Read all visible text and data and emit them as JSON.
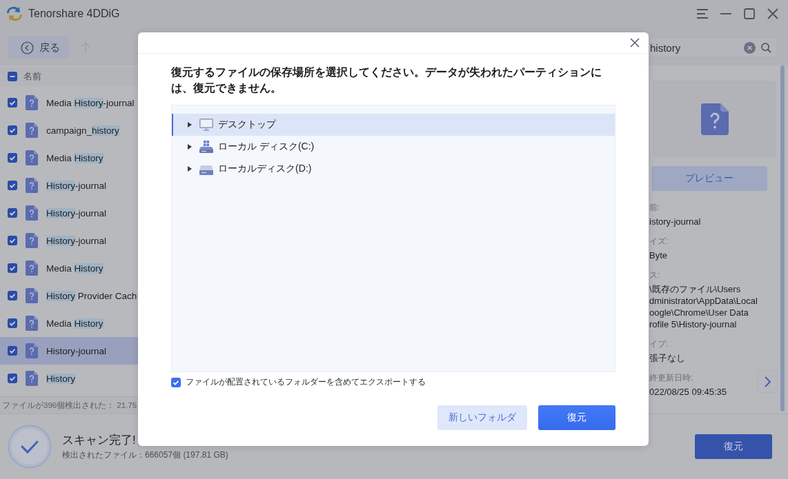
{
  "window": {
    "title": "Tenorshare 4DDiG"
  },
  "toolbar": {
    "back_button": "戻る",
    "up_button": {
      "disabled": true
    },
    "search": {
      "value": "history"
    }
  },
  "file_list": {
    "header": {
      "label": "名前",
      "partial": true
    },
    "rows": [
      {
        "name_parts": [
          {
            "text": "Media ",
            "match": false
          },
          {
            "text": "History",
            "match": true
          },
          {
            "text": "-journal",
            "match": false
          }
        ],
        "checked": true,
        "selected": false
      },
      {
        "name_parts": [
          {
            "text": "campaign_",
            "match": false
          },
          {
            "text": "history",
            "match": true
          }
        ],
        "checked": true,
        "selected": false
      },
      {
        "name_parts": [
          {
            "text": "Media ",
            "match": false
          },
          {
            "text": "History",
            "match": true
          }
        ],
        "checked": true,
        "selected": false
      },
      {
        "name_parts": [
          {
            "text": "History",
            "match": true
          },
          {
            "text": "-journal",
            "match": false
          }
        ],
        "checked": true,
        "selected": false
      },
      {
        "name_parts": [
          {
            "text": "History",
            "match": true
          },
          {
            "text": "-journal",
            "match": false
          }
        ],
        "checked": true,
        "selected": false
      },
      {
        "name_parts": [
          {
            "text": "History",
            "match": true
          },
          {
            "text": "-journal",
            "match": false
          }
        ],
        "checked": true,
        "selected": false
      },
      {
        "name_parts": [
          {
            "text": "Media ",
            "match": false
          },
          {
            "text": "History",
            "match": true
          }
        ],
        "checked": true,
        "selected": false
      },
      {
        "name_parts": [
          {
            "text": "History",
            "match": true
          },
          {
            "text": " Provider Cach",
            "match": false
          }
        ],
        "checked": true,
        "selected": false
      },
      {
        "name_parts": [
          {
            "text": "Media ",
            "match": false
          },
          {
            "text": "History",
            "match": true
          }
        ],
        "checked": true,
        "selected": false
      },
      {
        "name_parts": [
          {
            "text": "History-journal"
          }
        ],
        "checked": true,
        "selected": true
      },
      {
        "name_parts": [
          {
            "text": "History",
            "match": true
          }
        ],
        "checked": true,
        "selected": false
      }
    ],
    "status": "ファイルが396個検出された： 21.75"
  },
  "details_panel": {
    "preview_button": "プレビュー",
    "fields": [
      {
        "label": "前:",
        "values": [
          "istory-journal"
        ]
      },
      {
        "label": "イズ:",
        "values": [
          "Byte"
        ]
      },
      {
        "label": "ス:",
        "values": [
          "\\既存のファイル\\Users",
          "dministrator\\AppData\\Local",
          "oogle\\Chrome\\User Data",
          "rofile 5\\History-journal"
        ]
      },
      {
        "label": "イプ:",
        "values": [
          "張子なし"
        ]
      },
      {
        "label": "終更新日時:",
        "values": [
          "022/08/25 09:45:35"
        ]
      }
    ]
  },
  "bottom_bar": {
    "title": "スキャン完了!",
    "summary": "検出されたファイル：666057個 (197.81 GB)",
    "recover_button": "復元"
  },
  "dialog": {
    "title": "復元するファイルの保存場所を選択してください。データが失われたパーティションには、復元できません。",
    "tree": [
      {
        "label": "デスクトップ",
        "kind": "desktop",
        "expanded": false,
        "selected": true
      },
      {
        "label": "ローカル ディスク(C:)",
        "kind": "system-drive",
        "expanded": false,
        "selected": false
      },
      {
        "label": "ローカルディスク(D:)",
        "kind": "drive",
        "expanded": false,
        "selected": false
      }
    ],
    "export_option": {
      "label": "ファイルが配置されているフォルダーを含めてエクスポートする",
      "checked": true
    },
    "new_folder_button": "新しいフォルダ",
    "restore_button": "復元"
  }
}
